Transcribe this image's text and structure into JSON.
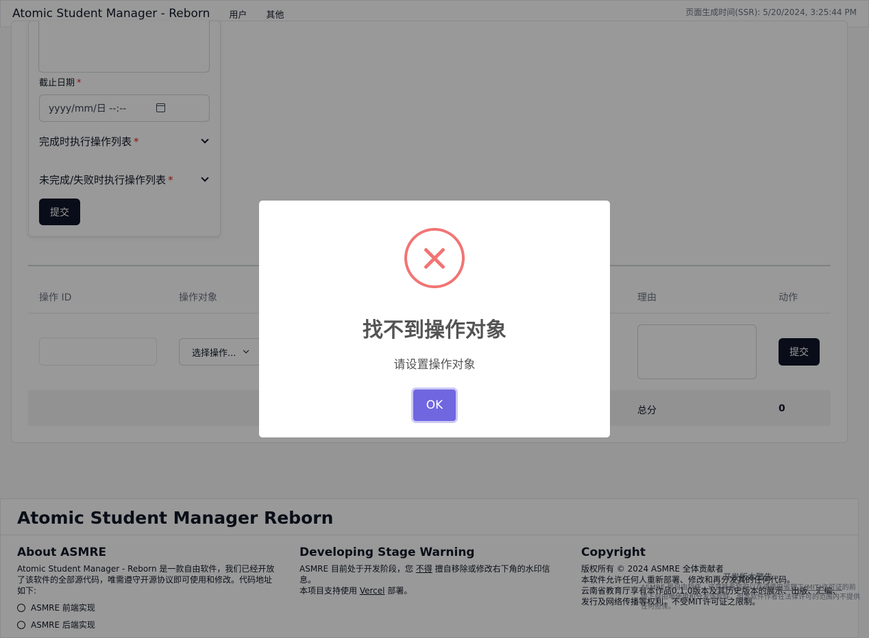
{
  "topbar": {
    "brand": "Atomic Student Manager - Reborn",
    "nav": [
      "用户",
      "其他"
    ],
    "ssr_time": "页面生成时间(SSR): 5/20/2024, 3:25:44 PM"
  },
  "form": {
    "deadline_label": "截止日期",
    "required_mark": "*",
    "date_placeholder": "yyyy/mm/日 --:--",
    "accordion_success": "完成时执行操作列表",
    "accordion_fail": "未完成/失败时执行操作列表",
    "submit_label": "提交"
  },
  "table": {
    "headers": [
      "操作 ID",
      "操作对象",
      "理由",
      "动作"
    ],
    "select_value": "选择操作...",
    "row_submit": "提交",
    "total_label": "总分",
    "total_value": "0"
  },
  "footer": {
    "title": "Atomic Student Manager Reborn",
    "about": {
      "heading": "About ASMRE",
      "text": "Atomic Student Manager - Reborn 是一款自由软件，我们已经开放了该软件的全部源代码，唯需遵守开源协议即可使用和修改。代码地址如下:",
      "links": [
        "ASMRE 前端实现",
        "ASMRE 后端实现"
      ]
    },
    "warning": {
      "heading": "Developing Stage Warning",
      "text_pre": "ASMRE 目前处于开发阶段，您",
      "text_link": "不得",
      "text_post": "擅自移除或修改右下角的水印信息。",
      "deploy_pre": "本项目支持使用",
      "deploy_link": "Vercel",
      "deploy_post": "部署。"
    },
    "copyright": {
      "heading": "Copyright",
      "lines": [
        "版权所有 © 2024 ASMRE 全体贡献者",
        "本软件允许任何人重新部署、修改和再分发其的任何代码。",
        "云南省教育厅享有本作品0.1.0版本及其历史版本的展示、出版、汇编、发行及网络传播等权利，不受MIT许可证之限制。"
      ]
    },
    "watermark": {
      "title": "开发版本警告",
      "text_pre": "ASMRE 是自由软件，这意味着您可以在遵循",
      "license": "麻省理工(MIT)许可证",
      "text_post": "的前提下自由地使用和分发该软件，但本软件作者在法律许可的范围内不提供任何担保。"
    }
  },
  "dialog": {
    "title": "找不到操作对象",
    "message": "请设置操作对象",
    "ok_label": "OK",
    "icon_color": "#f27474",
    "button_color": "#7066e0"
  }
}
